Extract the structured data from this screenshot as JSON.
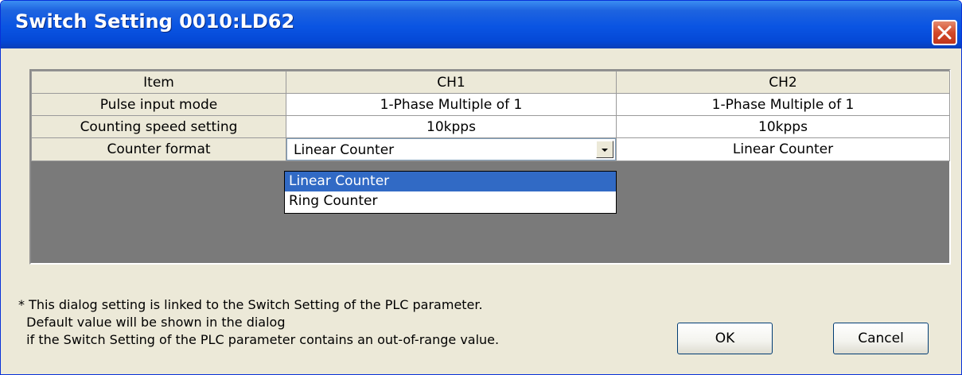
{
  "window": {
    "title": "Switch Setting 0010:LD62",
    "close_icon": "close-icon"
  },
  "grid": {
    "headers": [
      "Item",
      "CH1",
      "CH2"
    ],
    "rows": [
      {
        "item": "Pulse input mode",
        "ch1": "1-Phase Multiple of 1",
        "ch2": "1-Phase Multiple of 1"
      },
      {
        "item": "Counting speed setting",
        "ch1": "10kpps",
        "ch2": "10kpps"
      },
      {
        "item": "Counter format",
        "ch1": "Linear Counter",
        "ch2": "Linear Counter"
      }
    ]
  },
  "dropdown": {
    "options": [
      "Linear Counter",
      "Ring Counter"
    ],
    "selected": "Linear Counter"
  },
  "note": {
    "line1": "* This dialog setting is linked to the Switch Setting of the PLC parameter.",
    "line2": "  Default value will be shown in the dialog",
    "line3": "  if the Switch Setting of the PLC parameter contains an out-of-range value."
  },
  "buttons": {
    "ok": "OK",
    "cancel": "Cancel"
  },
  "colors": {
    "titlebar": "#0a54e2",
    "dialog_bg": "#ece9d8",
    "grid_empty_area": "#7a7a7a",
    "selection": "#316ac5",
    "close_button": "#d2492a"
  }
}
